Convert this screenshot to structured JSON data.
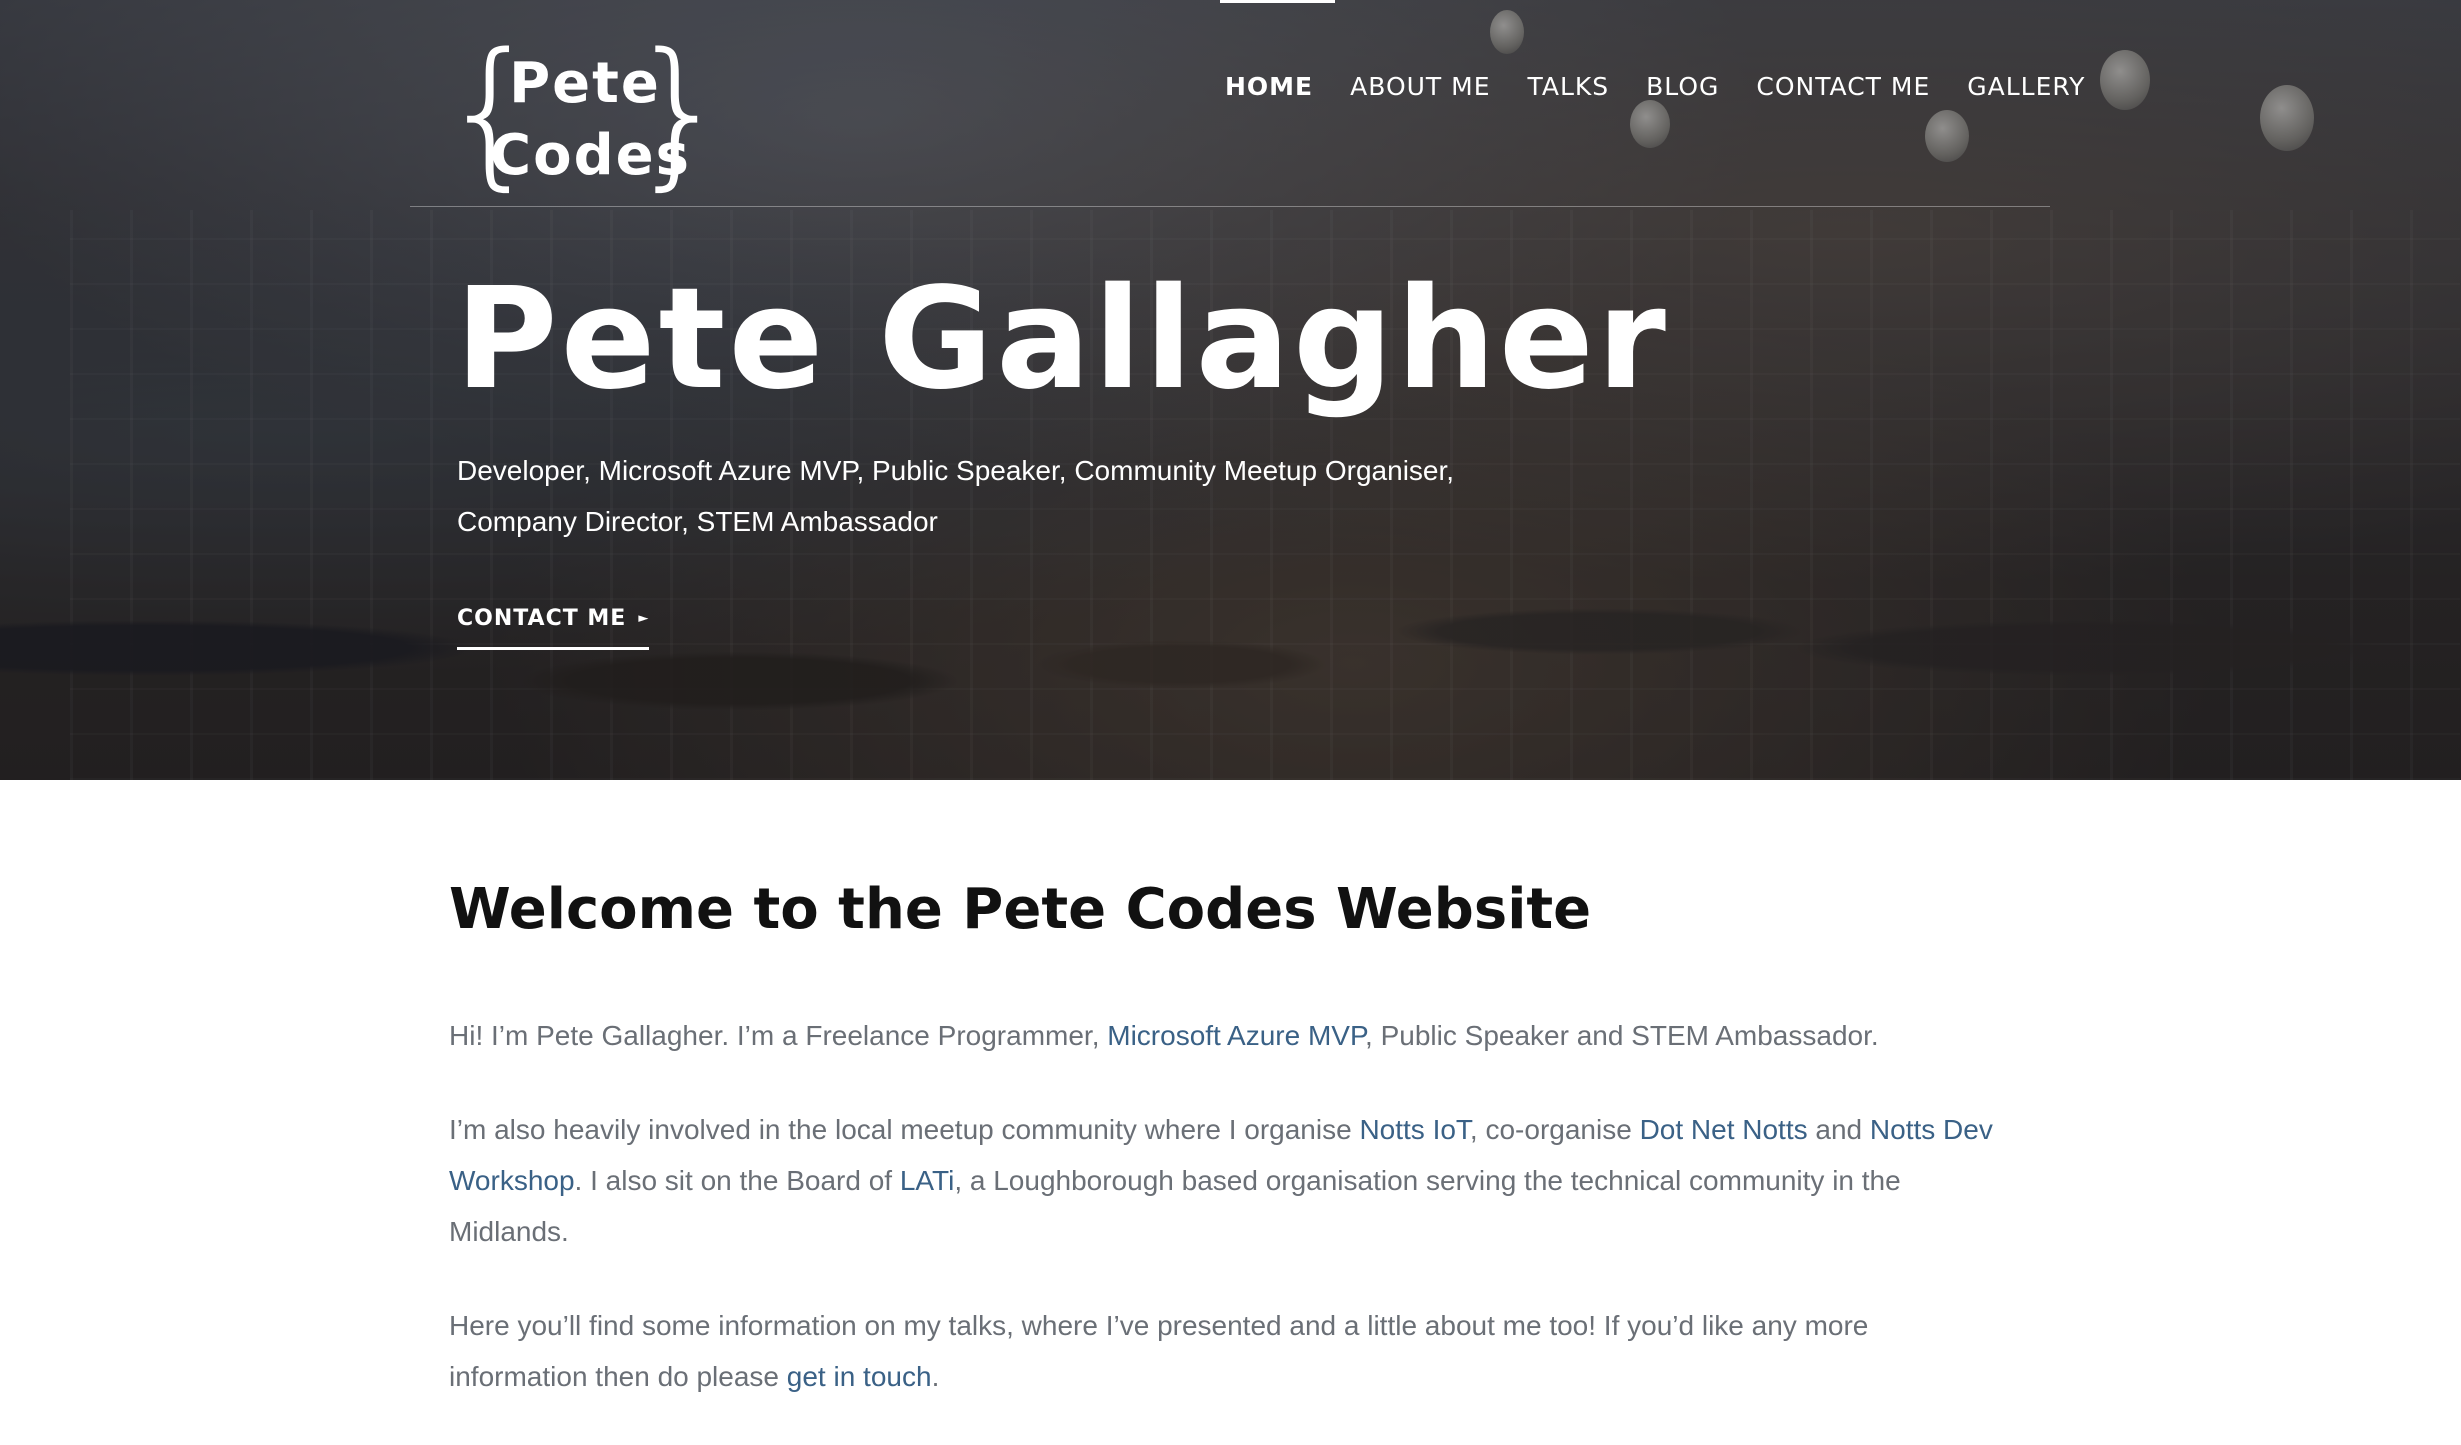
{
  "logo": {
    "line1": "Pete",
    "line2": "Codes",
    "brace_open": "{",
    "brace_close": "}"
  },
  "nav": {
    "items": [
      {
        "label": "HOME",
        "active": true
      },
      {
        "label": "ABOUT ME"
      },
      {
        "label": "TALKS"
      },
      {
        "label": "BLOG"
      },
      {
        "label": "CONTACT ME"
      },
      {
        "label": "GALLERY"
      }
    ]
  },
  "hero": {
    "title": "Pete Gallagher",
    "subtitle_line1": "Developer, Microsoft Azure MVP, Public Speaker, Community Meetup Organiser,",
    "subtitle_line2": "Company Director, STEM Ambassador",
    "cta_label": "CONTACT ME",
    "cta_arrow": "►"
  },
  "main": {
    "heading": "Welcome to the Pete Codes Website",
    "p1": {
      "before": "Hi! I’m Pete Gallagher. I’m a Freelance Programmer, ",
      "link": "Microsoft Azure MVP",
      "after": ", Public Speaker and STEM Ambassador."
    },
    "p2": {
      "t1": "I’m also heavily involved in the local meetup community where I organise ",
      "l1": "Notts IoT",
      "t2": ", co-organise ",
      "l2": "Dot Net Notts",
      "t3": " and ",
      "l3": "Notts Dev Workshop",
      "t4": ". I also sit on the Board of ",
      "l4": "LATi",
      "t5": ", a Loughborough based organisation serving the technical community in the Midlands."
    },
    "p3": {
      "before": "Here you’ll find some information on my talks, where I’ve presented and a little about me too! If you’d like any more information then do please ",
      "link": "get in touch",
      "after": "."
    }
  },
  "colors": {
    "link": "#3a6186",
    "body_text": "#6a6f76",
    "heading": "#111111",
    "hero_text": "#ffffff"
  }
}
